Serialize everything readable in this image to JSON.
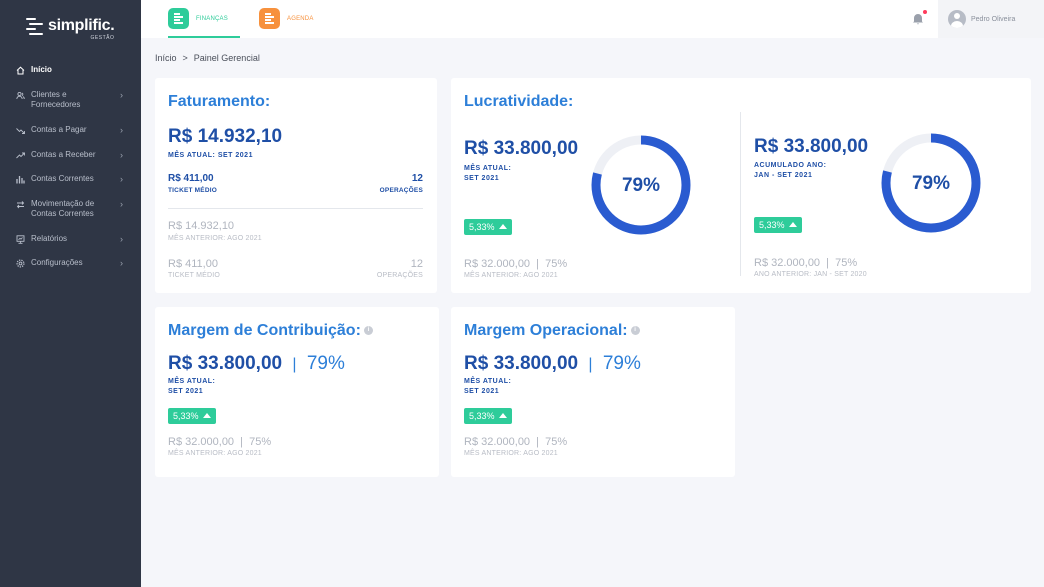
{
  "brand": {
    "name": "simplific.",
    "sub": "GESTÃO"
  },
  "sidebar": {
    "items": [
      {
        "label": "Início",
        "icon": "home-icon"
      },
      {
        "label": "Clientes e Fornecedores",
        "icon": "users-icon"
      },
      {
        "label": "Contas a Pagar",
        "icon": "trend-down-icon"
      },
      {
        "label": "Contas a Receber",
        "icon": "trend-up-icon"
      },
      {
        "label": "Contas Correntes",
        "icon": "bar-chart-icon"
      },
      {
        "label": "Movimentação de Contas Correntes",
        "icon": "transfer-icon"
      },
      {
        "label": "Relatórios",
        "icon": "report-icon"
      },
      {
        "label": "Configurações",
        "icon": "gear-icon"
      }
    ]
  },
  "topbar": {
    "tabs": [
      {
        "label": "FINANÇAS"
      },
      {
        "label": "AGENDA"
      }
    ],
    "user_name": "Pedro Oliveira"
  },
  "breadcrumb": {
    "home": "Início",
    "sep": ">",
    "current": "Painel Gerencial"
  },
  "faturamento": {
    "title": "Faturamento:",
    "value": "R$ 14.932,10",
    "period_label": "MÊS ATUAL: SET 2021",
    "ticket_value": "R$ 411,00",
    "ticket_label": "TICKET MÉDIO",
    "ops_value": "12",
    "ops_label": "OPERAÇÕES",
    "prev_value": "R$ 14.932,10",
    "prev_label": "MÊS ANTERIOR: AGO 2021",
    "prev_ticket_value": "R$ 411,00",
    "prev_ticket_label": "TICKET MÉDIO",
    "prev_ops_value": "12",
    "prev_ops_label": "OPERAÇÕES"
  },
  "lucratividade": {
    "title": "Lucratividade:",
    "left": {
      "value": "R$ 33.800,00",
      "label1": "MÊS ATUAL:",
      "label2": "SET 2021",
      "percent_text": "79%",
      "percent": 79,
      "badge": "5,33%",
      "prev": "R$ 32.000,00  |  75%",
      "prev_label": "MÊS ANTERIOR: AGO 2021"
    },
    "right": {
      "value": "R$ 33.800,00",
      "label1": "ACUMULADO ANO:",
      "label2": "JAN - SET 2021",
      "percent_text": "79%",
      "percent": 79,
      "badge": "5,33%",
      "prev": "R$ 32.000,00  |  75%",
      "prev_label": "ANO ANTERIOR: JAN - SET 2020"
    }
  },
  "margem_contribuicao": {
    "title": "Margem de Contribuição:",
    "value": "R$ 33.800,00",
    "sep": "|",
    "percent": "79%",
    "label1": "MÊS ATUAL:",
    "label2": "SET 2021",
    "badge": "5,33%",
    "prev": "R$ 32.000,00  |  75%",
    "prev_label": "MÊS ANTERIOR: AGO 2021"
  },
  "margem_operacional": {
    "title": "Margem Operacional:",
    "value": "R$ 33.800,00",
    "sep": "|",
    "percent": "79%",
    "label1": "MÊS ATUAL:",
    "label2": "SET 2021",
    "badge": "5,33%",
    "prev": "R$ 32.000,00  |  75%",
    "prev_label": "MÊS ANTERIOR: AGO 2021"
  },
  "colors": {
    "sidebar": "#2f3645",
    "accent_green": "#2ecc9a",
    "accent_orange": "#f7913d",
    "title_blue": "#2d7fd8",
    "value_navy": "#1f4fa6",
    "donut": "#2a5bd0",
    "donut_track": "#eef0f5",
    "alert_red": "#ff3b5c"
  }
}
